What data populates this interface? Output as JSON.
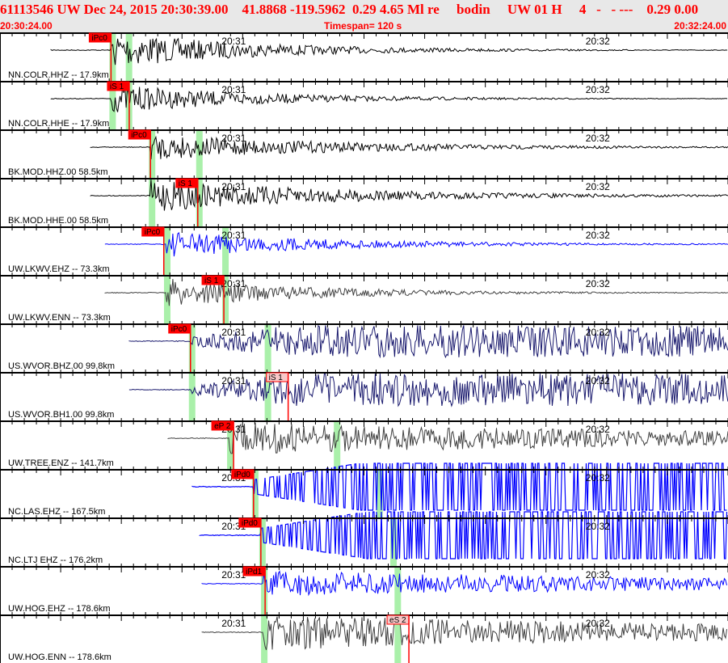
{
  "header": {
    "title": "61113546 UW Dec 24, 2015 20:30:39.00    41.8868 -119.5962  0.29 4.65 Ml re     bodin     UW 01 H     4   -   - ---    0.29 0.00",
    "start_time": "20:30:24.00",
    "timespan": "Timespan= 120 s",
    "end_time": "20:32:24.00"
  },
  "time_axis": {
    "duration_s": 120,
    "minute_marks": [
      {
        "label": "20:31",
        "t": 36
      },
      {
        "label": "20:32",
        "t": 96
      }
    ]
  },
  "colors": {
    "pick_fill": "#ff0000",
    "pick_light": "#f8c8c8",
    "band": "#aaf0aa",
    "black": "#000000",
    "blue": "#0000ff",
    "gray": "#404040",
    "navy": "#1a1a6e"
  },
  "channels": [
    {
      "label": "NN.COLR.HHZ -- 17.9km",
      "color": "#000000",
      "start_s": 8.4,
      "pick": {
        "label": "iPc0",
        "t": 18.3,
        "filled": true
      },
      "bands": [
        18.3,
        21.0
      ],
      "amp": 22,
      "decay": 0.04
    },
    {
      "label": "NN.COLR.HHE -- 17.9km",
      "color": "#000000",
      "start_s": 8.4,
      "pick": {
        "label": "iS 1",
        "t": 21.3,
        "filled": true
      },
      "bands": [
        18.3,
        21.0
      ],
      "amp": 18,
      "decay": 0.04
    },
    {
      "label": "BK.MOD.HHZ.00 58.5km",
      "color": "#000000",
      "start_s": 14.9,
      "pick": {
        "label": "iPc0",
        "t": 24.8,
        "filled": true
      },
      "bands": [
        24.8,
        32.6
      ],
      "amp": 16,
      "decay": 0.03
    },
    {
      "label": "BK.MOD.HHE.00 58.5km",
      "color": "#000000",
      "start_s": 14.9,
      "pick": {
        "label": "iS 1",
        "t": 32.6,
        "filled": true
      },
      "bands": [
        24.8,
        32.6
      ],
      "amp": 20,
      "decay": 0.03
    },
    {
      "label": "UW.LKWV.EHZ -- 73.3km",
      "color": "#0000ff",
      "start_s": 17.3,
      "pick": {
        "label": "iPc0",
        "t": 27.0,
        "filled": true
      },
      "bands": [
        27.3,
        36.9
      ],
      "amp": 16,
      "decay": 0.035
    },
    {
      "label": "UW.LKWV.ENN -- 73.3km",
      "color": "#404040",
      "start_s": 17.3,
      "pick": {
        "label": "iS 1",
        "t": 36.9,
        "filled": true
      },
      "bands": [
        27.3,
        36.9
      ],
      "amp": 18,
      "decay": 0.04
    },
    {
      "label": "US.WVOR.BHZ.00 99.8km",
      "color": "#1a1a6e",
      "start_s": 21.3,
      "pick": {
        "label": "iPc0",
        "t": 31.4,
        "filled": true
      },
      "bands": [
        31.4,
        43.9
      ],
      "amp": 20,
      "decay": 0.0
    },
    {
      "label": "US.WVOR.BH1.00 99.8km",
      "color": "#1a1a6e",
      "start_s": 21.3,
      "pick": {
        "label": "iS 1",
        "t": 47.5,
        "filled": false
      },
      "bands": [
        31.4,
        43.9
      ],
      "amp": 20,
      "decay": 0.0
    },
    {
      "label": "UW.TREE.ENZ -- 141.7km",
      "color": "#404040",
      "start_s": 27.7,
      "pick": {
        "label": "eP 2",
        "t": 38.5,
        "filled": true
      },
      "bands": [
        37.7,
        55.3
      ],
      "amp": 20,
      "decay": 0.01
    },
    {
      "label": "NC.LAS.EHZ -- 167.5km",
      "color": "#0000ff",
      "start_s": 31.7,
      "pick": {
        "label": "iPd0",
        "t": 41.8,
        "filled": true
      },
      "bands": [
        41.8,
        62.3
      ],
      "amp": 29,
      "decay": 0.0
    },
    {
      "label": "NC.LTJ EHZ -- 176.2km",
      "color": "#0000ff",
      "start_s": 32.9,
      "pick": {
        "label": "iPd0",
        "t": 43.0,
        "filled": true
      },
      "bands": [
        43.0,
        64.6
      ],
      "amp": 29,
      "decay": 0.0
    },
    {
      "label": "UW.HOG.EHZ -- 178.6km",
      "color": "#0000ff",
      "start_s": 33.3,
      "pick": {
        "label": "iPd1",
        "t": 43.7,
        "filled": true
      },
      "bands": [
        43.3,
        65.3
      ],
      "amp": 16,
      "decay": 0.01
    },
    {
      "label": "UW.HOG.ENN -- 178.6km",
      "color": "#404040",
      "start_s": 33.3,
      "pick": {
        "label": "eS 2",
        "t": 67.4,
        "filled": false
      },
      "bands": [
        43.3,
        65.3
      ],
      "amp": 22,
      "decay": 0.01
    }
  ]
}
